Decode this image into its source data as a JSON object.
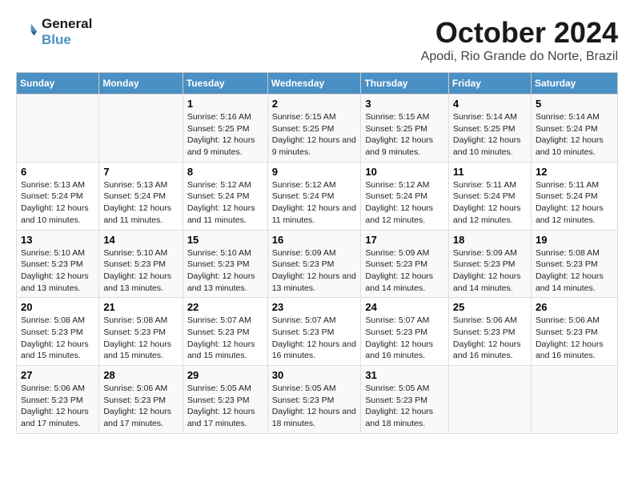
{
  "logo": {
    "line1": "General",
    "line2": "Blue"
  },
  "title": "October 2024",
  "subtitle": "Apodi, Rio Grande do Norte, Brazil",
  "headers": [
    "Sunday",
    "Monday",
    "Tuesday",
    "Wednesday",
    "Thursday",
    "Friday",
    "Saturday"
  ],
  "weeks": [
    [
      {
        "day": "",
        "info": ""
      },
      {
        "day": "",
        "info": ""
      },
      {
        "day": "1",
        "info": "Sunrise: 5:16 AM\nSunset: 5:25 PM\nDaylight: 12 hours and 9 minutes."
      },
      {
        "day": "2",
        "info": "Sunrise: 5:15 AM\nSunset: 5:25 PM\nDaylight: 12 hours and 9 minutes."
      },
      {
        "day": "3",
        "info": "Sunrise: 5:15 AM\nSunset: 5:25 PM\nDaylight: 12 hours and 9 minutes."
      },
      {
        "day": "4",
        "info": "Sunrise: 5:14 AM\nSunset: 5:25 PM\nDaylight: 12 hours and 10 minutes."
      },
      {
        "day": "5",
        "info": "Sunrise: 5:14 AM\nSunset: 5:24 PM\nDaylight: 12 hours and 10 minutes."
      }
    ],
    [
      {
        "day": "6",
        "info": "Sunrise: 5:13 AM\nSunset: 5:24 PM\nDaylight: 12 hours and 10 minutes."
      },
      {
        "day": "7",
        "info": "Sunrise: 5:13 AM\nSunset: 5:24 PM\nDaylight: 12 hours and 11 minutes."
      },
      {
        "day": "8",
        "info": "Sunrise: 5:12 AM\nSunset: 5:24 PM\nDaylight: 12 hours and 11 minutes."
      },
      {
        "day": "9",
        "info": "Sunrise: 5:12 AM\nSunset: 5:24 PM\nDaylight: 12 hours and 11 minutes."
      },
      {
        "day": "10",
        "info": "Sunrise: 5:12 AM\nSunset: 5:24 PM\nDaylight: 12 hours and 12 minutes."
      },
      {
        "day": "11",
        "info": "Sunrise: 5:11 AM\nSunset: 5:24 PM\nDaylight: 12 hours and 12 minutes."
      },
      {
        "day": "12",
        "info": "Sunrise: 5:11 AM\nSunset: 5:24 PM\nDaylight: 12 hours and 12 minutes."
      }
    ],
    [
      {
        "day": "13",
        "info": "Sunrise: 5:10 AM\nSunset: 5:23 PM\nDaylight: 12 hours and 13 minutes."
      },
      {
        "day": "14",
        "info": "Sunrise: 5:10 AM\nSunset: 5:23 PM\nDaylight: 12 hours and 13 minutes."
      },
      {
        "day": "15",
        "info": "Sunrise: 5:10 AM\nSunset: 5:23 PM\nDaylight: 12 hours and 13 minutes."
      },
      {
        "day": "16",
        "info": "Sunrise: 5:09 AM\nSunset: 5:23 PM\nDaylight: 12 hours and 13 minutes."
      },
      {
        "day": "17",
        "info": "Sunrise: 5:09 AM\nSunset: 5:23 PM\nDaylight: 12 hours and 14 minutes."
      },
      {
        "day": "18",
        "info": "Sunrise: 5:09 AM\nSunset: 5:23 PM\nDaylight: 12 hours and 14 minutes."
      },
      {
        "day": "19",
        "info": "Sunrise: 5:08 AM\nSunset: 5:23 PM\nDaylight: 12 hours and 14 minutes."
      }
    ],
    [
      {
        "day": "20",
        "info": "Sunrise: 5:08 AM\nSunset: 5:23 PM\nDaylight: 12 hours and 15 minutes."
      },
      {
        "day": "21",
        "info": "Sunrise: 5:08 AM\nSunset: 5:23 PM\nDaylight: 12 hours and 15 minutes."
      },
      {
        "day": "22",
        "info": "Sunrise: 5:07 AM\nSunset: 5:23 PM\nDaylight: 12 hours and 15 minutes."
      },
      {
        "day": "23",
        "info": "Sunrise: 5:07 AM\nSunset: 5:23 PM\nDaylight: 12 hours and 16 minutes."
      },
      {
        "day": "24",
        "info": "Sunrise: 5:07 AM\nSunset: 5:23 PM\nDaylight: 12 hours and 16 minutes."
      },
      {
        "day": "25",
        "info": "Sunrise: 5:06 AM\nSunset: 5:23 PM\nDaylight: 12 hours and 16 minutes."
      },
      {
        "day": "26",
        "info": "Sunrise: 5:06 AM\nSunset: 5:23 PM\nDaylight: 12 hours and 16 minutes."
      }
    ],
    [
      {
        "day": "27",
        "info": "Sunrise: 5:06 AM\nSunset: 5:23 PM\nDaylight: 12 hours and 17 minutes."
      },
      {
        "day": "28",
        "info": "Sunrise: 5:06 AM\nSunset: 5:23 PM\nDaylight: 12 hours and 17 minutes."
      },
      {
        "day": "29",
        "info": "Sunrise: 5:05 AM\nSunset: 5:23 PM\nDaylight: 12 hours and 17 minutes."
      },
      {
        "day": "30",
        "info": "Sunrise: 5:05 AM\nSunset: 5:23 PM\nDaylight: 12 hours and 18 minutes."
      },
      {
        "day": "31",
        "info": "Sunrise: 5:05 AM\nSunset: 5:23 PM\nDaylight: 12 hours and 18 minutes."
      },
      {
        "day": "",
        "info": ""
      },
      {
        "day": "",
        "info": ""
      }
    ]
  ]
}
